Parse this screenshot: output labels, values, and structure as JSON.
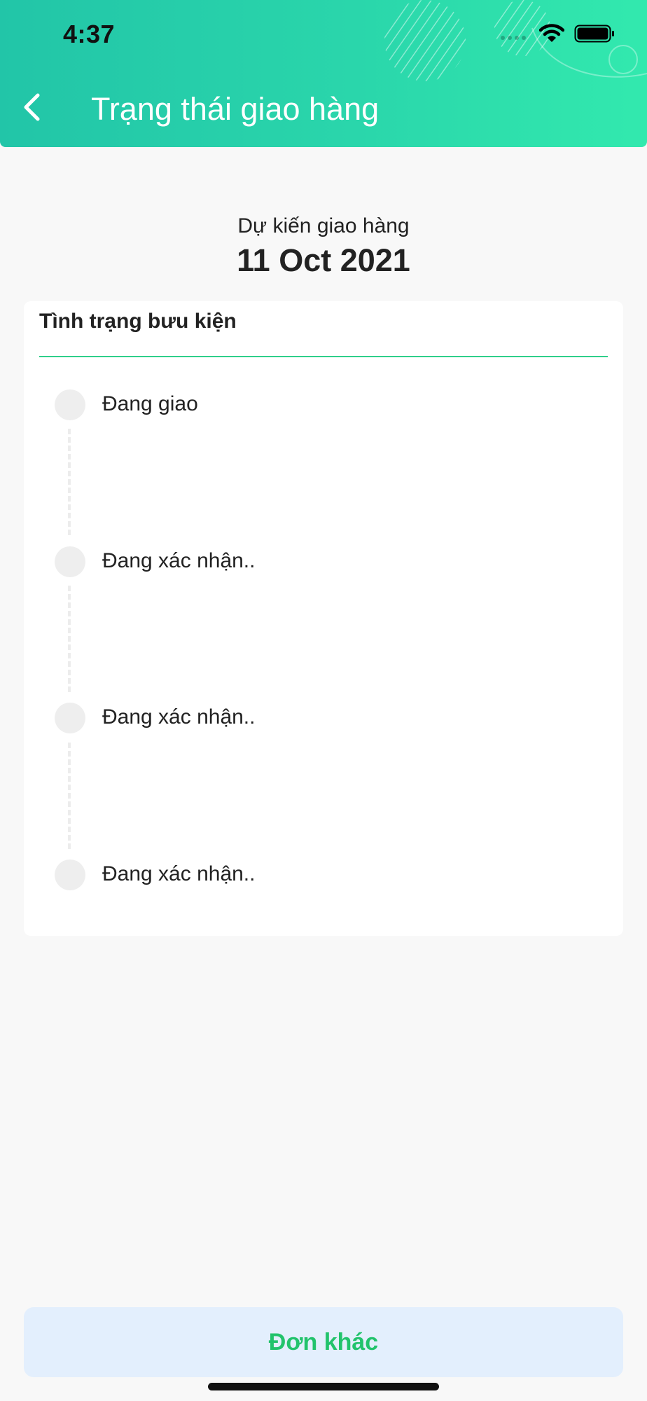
{
  "status_bar": {
    "time": "4:37",
    "icons": [
      "signal-icon",
      "wifi-icon",
      "battery-icon"
    ]
  },
  "header": {
    "title": "Trạng thái giao hàng",
    "back_icon": "chevron-left-icon"
  },
  "delivery": {
    "label": "Dự kiến giao hàng",
    "date": "11 Oct 2021"
  },
  "parcel_status": {
    "title": "Tình trạng bưu kiện",
    "steps": [
      {
        "label": "Đang giao"
      },
      {
        "label": "Đang xác nhận.."
      },
      {
        "label": "Đang xác nhận.."
      },
      {
        "label": "Đang xác nhận.."
      }
    ]
  },
  "footer": {
    "button_label": "Đơn khác"
  },
  "colors": {
    "header_gradient_start": "#22c5a8",
    "header_gradient_end": "#32e9ae",
    "accent_green": "#2fcf8a",
    "button_text": "#22c36c",
    "button_bg": "#e3effd",
    "page_bg": "#f8f8f8"
  }
}
